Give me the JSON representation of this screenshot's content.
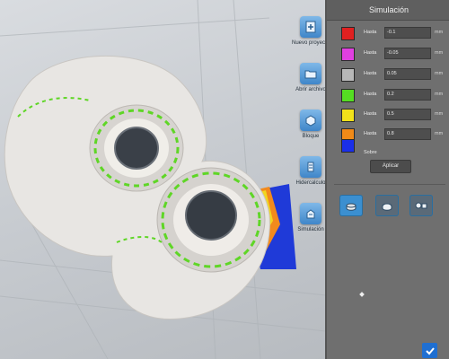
{
  "toolbar": {
    "items": [
      {
        "label": "Nuevo proyecto",
        "icon": "new-project-icon"
      },
      {
        "label": "Abrir archivo",
        "icon": "open-file-icon"
      },
      {
        "label": "Bloque",
        "icon": "block-icon"
      },
      {
        "label": "Hidercalculo",
        "icon": "calculate-icon"
      },
      {
        "label": "Simulación",
        "icon": "simulation-icon"
      }
    ]
  },
  "panel": {
    "title": "Simulación",
    "rows": [
      {
        "color": "#e02020",
        "caption": "Hasta",
        "value": "-0.1",
        "unit": "mm"
      },
      {
        "color": "#e040e0",
        "caption": "Hasta",
        "value": "-0.05",
        "unit": "mm"
      },
      {
        "color": "#b8b8b8",
        "caption": "Hasta",
        "value": "0.05",
        "unit": "mm"
      },
      {
        "color": "#55dd22",
        "caption": "Hasta",
        "value": "0.2",
        "unit": "mm"
      },
      {
        "color": "#f2e21a",
        "caption": "Hasta",
        "value": "0.5",
        "unit": "mm"
      },
      {
        "color": "#f08a18",
        "caption": "Hasta",
        "value": "0.8",
        "unit": "mm"
      },
      {
        "color": "#1a2fe8",
        "caption": "Sobre",
        "value": "",
        "unit": ""
      }
    ],
    "apply_label": "Aplicar",
    "view_buttons": [
      "view-mode-solid-icon",
      "view-mode-block-icon",
      "view-mode-compare-icon"
    ]
  },
  "colors": {
    "panel_bg": "#6f6f6f",
    "accent": "#3b8fd0"
  }
}
